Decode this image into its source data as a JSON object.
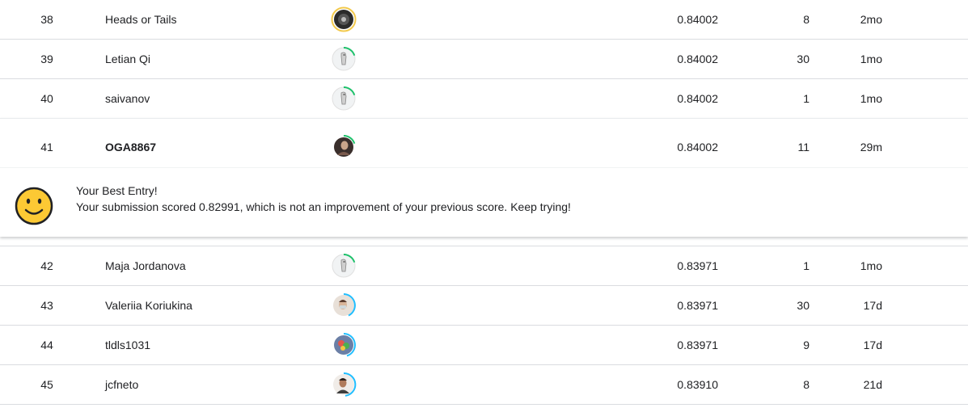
{
  "rows_above": [
    {
      "rank": "38",
      "team": "Heads or Tails",
      "score": "0.84002",
      "entries": "8",
      "last": "2mo",
      "avatar": "galaxy-avatar"
    },
    {
      "rank": "39",
      "team": "Letian Qi",
      "score": "0.84002",
      "entries": "30",
      "last": "1mo",
      "avatar": "default-avatar"
    },
    {
      "rank": "40",
      "team": "saivanov",
      "score": "0.84002",
      "entries": "1",
      "last": "1mo",
      "avatar": "default-avatar"
    }
  ],
  "highlight": {
    "rank": "41",
    "team": "OGA8867",
    "score": "0.84002",
    "entries": "11",
    "last": "29m",
    "avatar": "photo-avatar",
    "message_title": "Your Best Entry!",
    "message_body": "Your submission scored 0.82991, which is not an improvement of your previous score. Keep trying!",
    "icon": "smiley-icon"
  },
  "rows_below": [
    {
      "rank": "42",
      "team": "Maja Jordanova",
      "score": "0.83971",
      "entries": "1",
      "last": "1mo",
      "avatar": "default-avatar"
    },
    {
      "rank": "43",
      "team": "Valeriia Koriukina",
      "score": "0.83971",
      "entries": "30",
      "last": "17d",
      "avatar": "photo-avatar"
    },
    {
      "rank": "44",
      "team": "tldls1031",
      "score": "0.83971",
      "entries": "9",
      "last": "17d",
      "avatar": "colorful-avatar"
    },
    {
      "rank": "45",
      "team": "jcfneto",
      "score": "0.83910",
      "entries": "8",
      "last": "21d",
      "avatar": "photo-avatar"
    }
  ],
  "colors": {
    "tier_gold": "#f2c94c",
    "tier_green": "#20beff",
    "progress_green": "#1ec16b",
    "progress_blue": "#20beff",
    "border": "#dadce0"
  }
}
